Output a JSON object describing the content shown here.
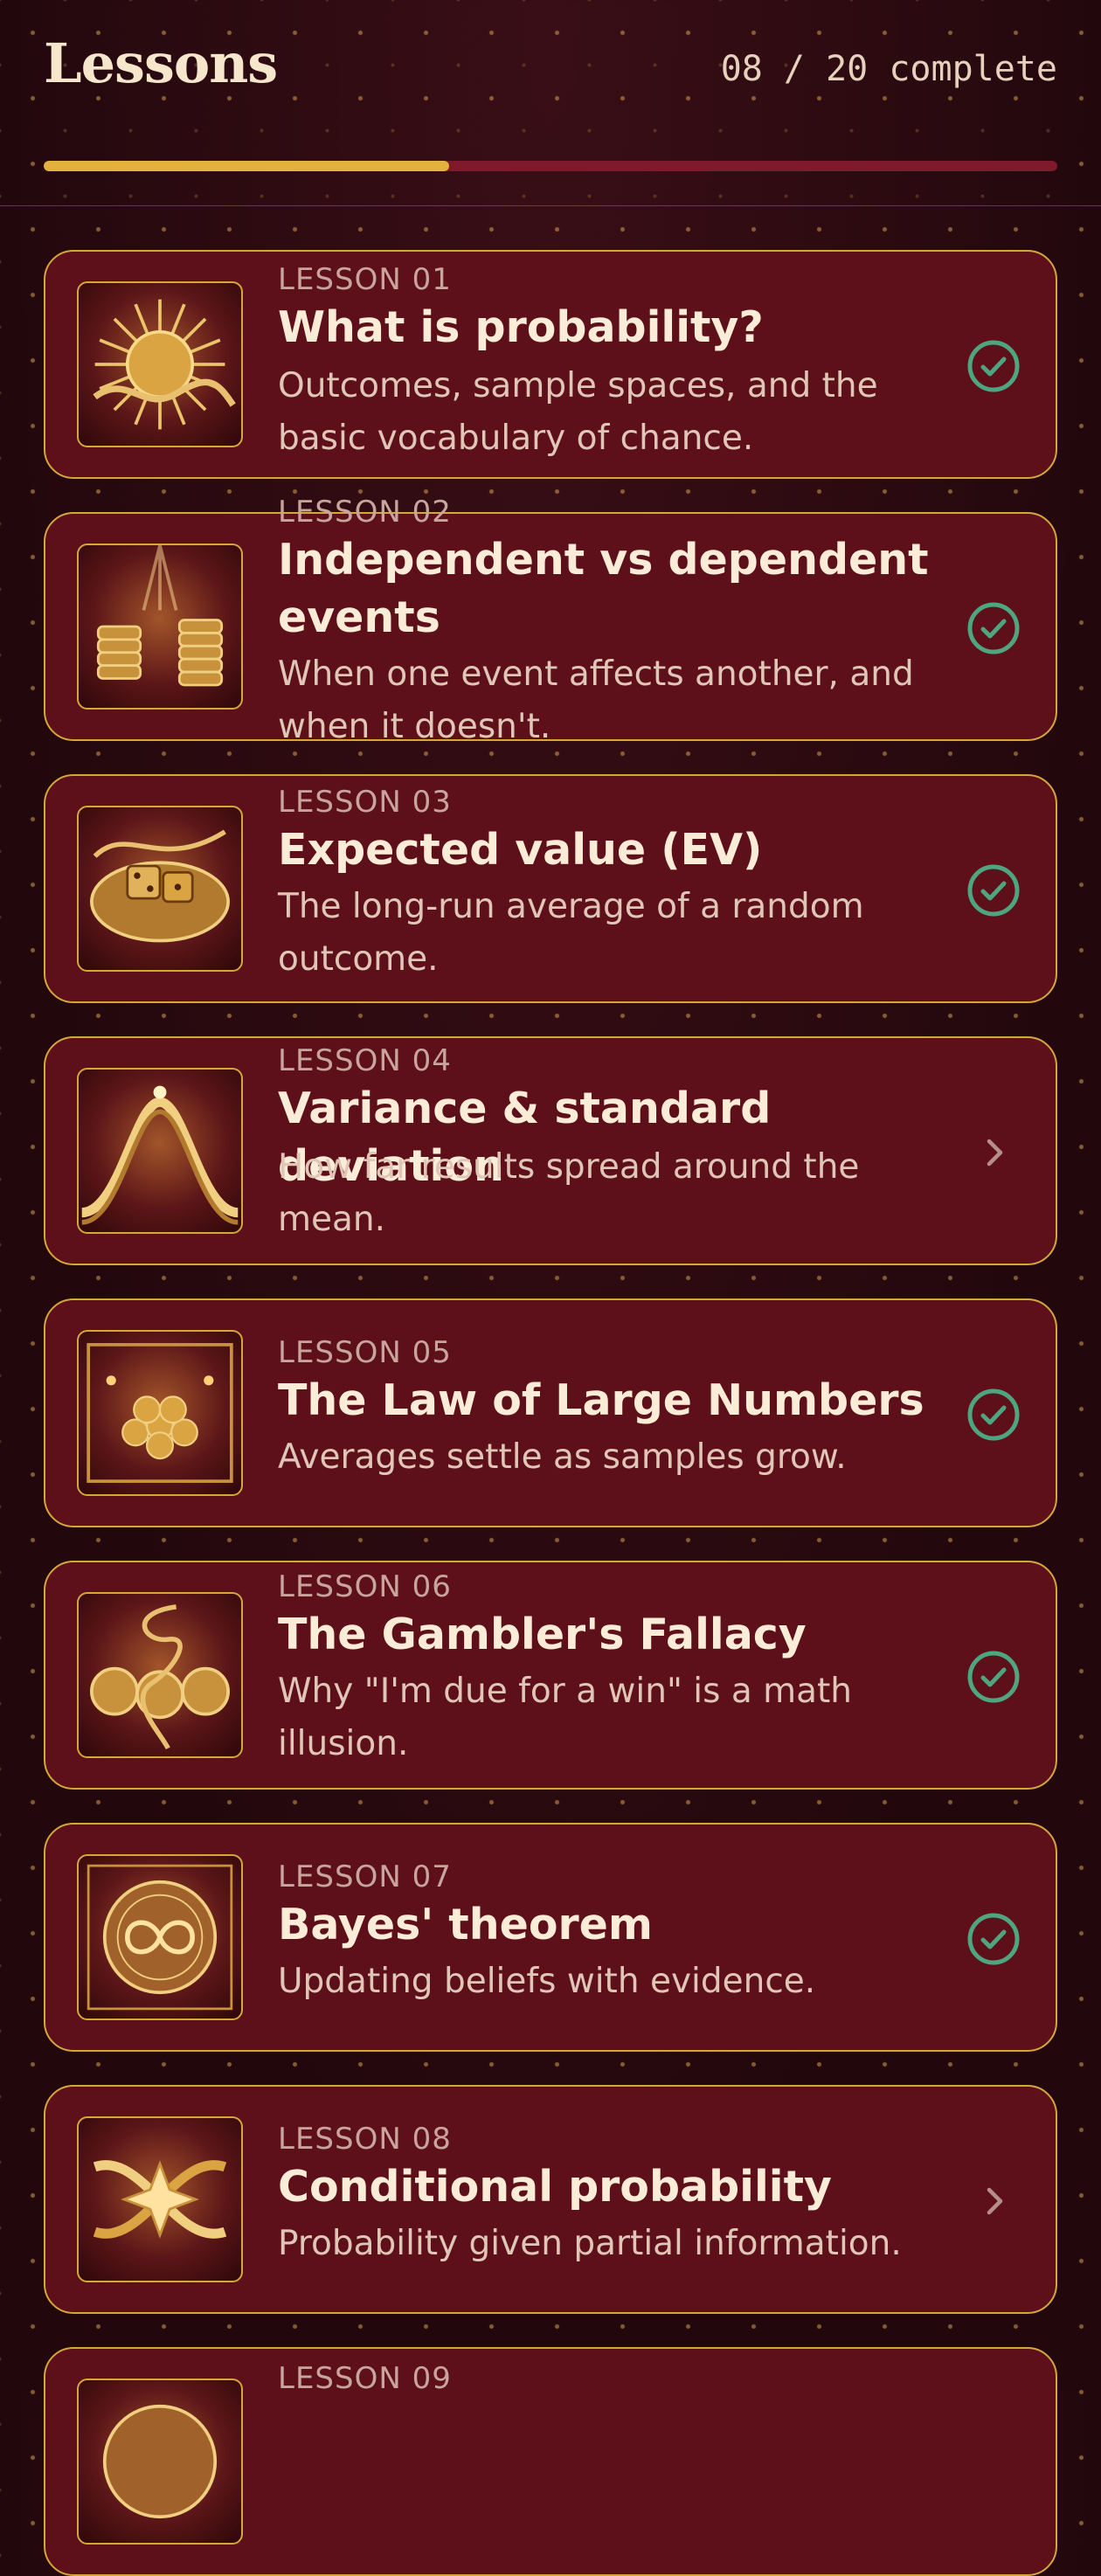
{
  "header": {
    "title": "Lessons",
    "progress_text": "08 / 20 complete",
    "progress_fraction": 0.4
  },
  "colors": {
    "accent_gold": "#e3b23c",
    "card_bg": "#5d0f1a",
    "complete_green": "#4ea57f",
    "track": "#7e1a2b"
  },
  "lessons": [
    {
      "label": "LESSON 01",
      "title": "What is probability?",
      "desc": "Outcomes, sample spaces, and the basic vocabulary of chance.",
      "status": "complete",
      "status_icon": "check-circle-icon",
      "thumb_icon": "golden-sun-icon"
    },
    {
      "label": "LESSON 02",
      "title": "Independent vs dependent events",
      "desc": "When one event affects another, and when it doesn't.",
      "status": "complete",
      "status_icon": "check-circle-icon",
      "thumb_icon": "coin-stacks-icon"
    },
    {
      "label": "LESSON 03",
      "title": "Expected value (EV)",
      "desc": "The long-run average of a random outcome.",
      "status": "complete",
      "status_icon": "check-circle-icon",
      "thumb_icon": "dice-icon"
    },
    {
      "label": "LESSON 04",
      "title": "Variance & standard deviation",
      "desc": "How far results spread around the mean.",
      "status": "incomplete",
      "status_icon": "chevron-right-icon",
      "thumb_icon": "bell-curve-icon"
    },
    {
      "label": "LESSON 05",
      "title": "The Law of Large Numbers",
      "desc": "Averages settle as samples grow.",
      "status": "complete",
      "status_icon": "check-circle-icon",
      "thumb_icon": "coin-pile-icon"
    },
    {
      "label": "LESSON 06",
      "title": "The Gambler's Fallacy",
      "desc": "Why \"I'm due for a win\" is a math illusion.",
      "status": "complete",
      "status_icon": "check-circle-icon",
      "thumb_icon": "three-coins-icon"
    },
    {
      "label": "LESSON 07",
      "title": "Bayes' theorem",
      "desc": "Updating beliefs with evidence.",
      "status": "complete",
      "status_icon": "check-circle-icon",
      "thumb_icon": "infinity-medallion-icon"
    },
    {
      "label": "LESSON 08",
      "title": "Conditional probability",
      "desc": "Probability given partial information.",
      "status": "incomplete",
      "status_icon": "chevron-right-icon",
      "thumb_icon": "ribbon-star-icon"
    },
    {
      "label": "LESSON 09",
      "title": "",
      "desc": "",
      "status": "",
      "status_icon": "",
      "thumb_icon": "medallion-icon"
    }
  ]
}
